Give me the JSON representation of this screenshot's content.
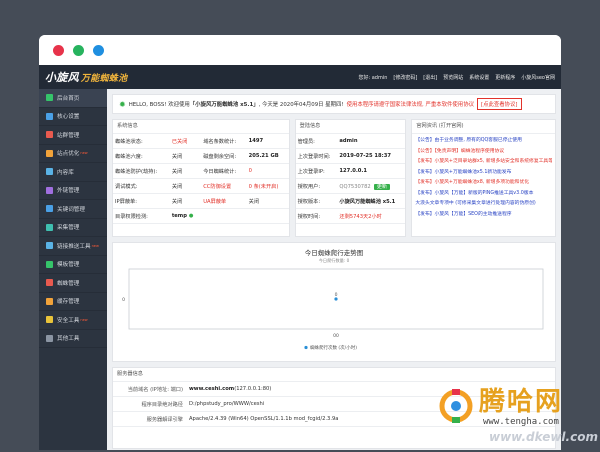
{
  "colors": {
    "dot1": "#e7334a",
    "dot2": "#27b35e",
    "dot3": "#1f8fe0"
  },
  "logo": {
    "main": "小旋风",
    "sub": "万能蜘蛛池"
  },
  "top_links": [
    "您好: admin",
    "[修改密码]",
    "[退出]",
    "预览网站",
    "系统设置",
    "更新程序",
    "小旋风seo官网"
  ],
  "sidebar": [
    {
      "label": "后台首页",
      "icon": "home-icon",
      "color": "#35c46a"
    },
    {
      "label": "核心设置",
      "icon": "settings-icon",
      "color": "#4aa0e6"
    },
    {
      "label": "站群管理",
      "icon": "site-group-icon",
      "color": "#e85a4f"
    },
    {
      "label": "站点优化",
      "icon": "optimize-icon",
      "color": "#f2a33a",
      "tag": "new"
    },
    {
      "label": "内容库",
      "icon": "content-icon",
      "color": "#5ab3e6"
    },
    {
      "label": "外链管理",
      "icon": "link-icon",
      "color": "#a06fe0"
    },
    {
      "label": "关键词管理",
      "icon": "keyword-icon",
      "color": "#4aa0e6"
    },
    {
      "label": "采集管理",
      "icon": "collect-icon",
      "color": "#3fbfb0"
    },
    {
      "label": "链接推送工具",
      "icon": "push-icon",
      "color": "#5ab3e6",
      "tag": "new"
    },
    {
      "label": "模板管理",
      "icon": "template-icon",
      "color": "#35c46a"
    },
    {
      "label": "蜘蛛管理",
      "icon": "spider-icon",
      "color": "#e85a4f"
    },
    {
      "label": "缓存管理",
      "icon": "cache-icon",
      "color": "#f2a33a"
    },
    {
      "label": "安全工具",
      "icon": "shield-icon",
      "color": "#e8c33a",
      "tag": "new"
    },
    {
      "label": "其他工具",
      "icon": "tools-icon",
      "color": "#8b95a3"
    }
  ],
  "notice": {
    "hello": "HELLO, BOSS! 欢迎使用",
    "product": "「小旋风万能蜘蛛池 x5.1」",
    "date": ", 今天是 2020年04月09日 星期四!",
    "warn": "使用本程序请遵守国家法律法规, 严重本软件使用协议",
    "btn": "[点此查看协议]"
  },
  "sysinfo": {
    "title": "系统信息",
    "rows": [
      [
        "蜘蛛池状态:",
        "已关闭",
        "域名条数统计:",
        "1497"
      ],
      [
        "蜘蛛池六度:",
        "关闭",
        "磁盘剩余空间:",
        "205.21 GB"
      ],
      [
        "蜘蛛池防护(劫持):",
        "关闭",
        "今日蜘蛛统计:",
        "0"
      ],
      [
        "调试模式:",
        "关闭",
        "CC防御设置",
        "0 条(未开启)"
      ],
      [
        "IP屏蔽单:",
        "关闭",
        "UA屏蔽单",
        "关闭"
      ],
      [
        "目录权限检测:",
        "temp",
        "",
        " "
      ]
    ]
  },
  "login": {
    "title": "登陆信息",
    "rows": [
      [
        "管理员:",
        "admin"
      ],
      [
        "上次登录时间:",
        "2019-07-25 18:37"
      ],
      [
        "上次登录IP:",
        "127.0.0.1"
      ],
      [
        "授权用户:",
        "QQ7530782"
      ],
      [
        "授权版本:",
        "小旋风万能蜘蛛池 x5.1"
      ],
      [
        "授权时间:",
        "还剩5743天2小时"
      ]
    ],
    "update_btn": "更新"
  },
  "news": {
    "title": "官网资讯 (打开官网)",
    "items": [
      {
        "text": "【公告】由于业务调整, 原有的QQ客服已停止使用",
        "red": false
      },
      {
        "text": "【公告】【免责声明】蜘蛛池程序使用协议",
        "red": true
      },
      {
        "text": "【发布】小旋风+泛目录站群x5, 新增多站安全和系统修复工具等",
        "red": true
      },
      {
        "text": "【发布】小旋风+万能蜘蛛池x5.1新功能发布",
        "red": false
      },
      {
        "text": "【发布】小旋风+万能蜘蛛池x8, 新增多项功能和优化",
        "red": true
      },
      {
        "text": "【发布】小旋风【万能】新版的PING推送工具v3.0版本",
        "red": false
      },
      {
        "text": "大浪头文章专项中 (可修采集文章进行处理内容的伪原创)",
        "red": false
      },
      {
        "text": "【发布】小旋风【万能】SEO的主动推送程序",
        "red": false
      }
    ]
  },
  "chart_data": {
    "type": "line",
    "title": "今日蜘蛛爬行走势图",
    "subtitle": "今日爬行数量: 0",
    "categories": [
      "00"
    ],
    "series": [
      {
        "name": "蜘蛛爬行次数 (次/小时)",
        "values": [
          0
        ]
      }
    ],
    "ylabel": "",
    "y_tick": "0",
    "ylim": [
      -1,
      1
    ],
    "legend": "bottom",
    "color": "#2a8fd6"
  },
  "server": {
    "title": "服务器信息",
    "rows": [
      [
        "当前域名 (IP地址: 端口)",
        "www.ceshi.com",
        "(127.0.0.1:80)"
      ],
      [
        "程序目录绝对路径",
        "D:/phpstudy_pro/WWW/ceshi",
        ""
      ],
      [
        "服务器解译引擎",
        "Apache/2.4.39 (Win64) OpenSSL/1.1.1b mod_fcgid/2.3.9a",
        ""
      ]
    ]
  },
  "watermark": {
    "name": "腾哈网",
    "url1": "www.tengha.com",
    "url2": "www.dkewl.com"
  }
}
